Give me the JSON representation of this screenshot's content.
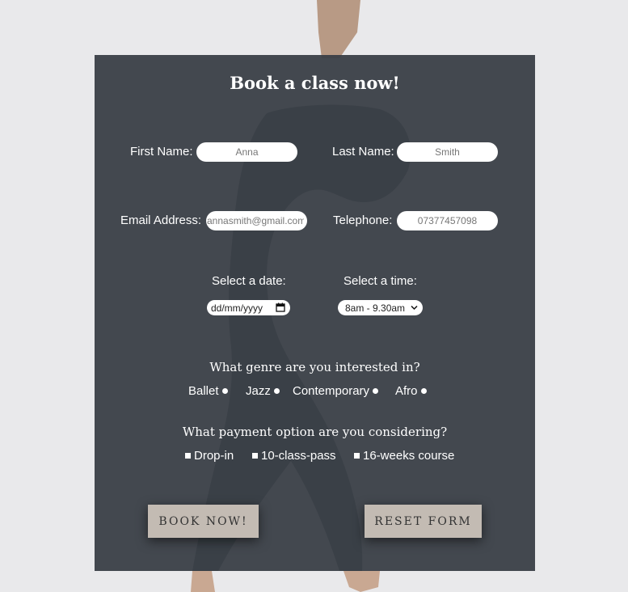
{
  "form": {
    "title": "Book a class now!",
    "first_name": {
      "label": "First Name:",
      "placeholder": "Anna"
    },
    "last_name": {
      "label": "Last Name:",
      "placeholder": "Smith"
    },
    "email": {
      "label": "Email Address:",
      "placeholder": "annasmith@gmail.com"
    },
    "telephone": {
      "label": "Telephone:",
      "placeholder": "07377457098"
    },
    "date": {
      "label": "Select a date:",
      "placeholder": "dd/mm/yyyy",
      "icon": "calendar-icon"
    },
    "time": {
      "label": "Select a time:",
      "selected": "8am - 9.30am",
      "icon": "chevron-down-icon"
    },
    "genre": {
      "question": "What genre are you interested in?",
      "options": [
        "Ballet",
        "Jazz",
        "Contemporary",
        "Afro"
      ]
    },
    "payment": {
      "question": "What payment option are you considering?",
      "options": [
        "Drop-in",
        "10-class-pass",
        "16-weeks course"
      ]
    },
    "buttons": {
      "book": "BOOK NOW!",
      "reset": "RESET FORM"
    }
  },
  "colors": {
    "page_background": "#e9e9eb",
    "panel": "#383e45",
    "button": "#c3bbb3",
    "text": "#ffffff"
  }
}
